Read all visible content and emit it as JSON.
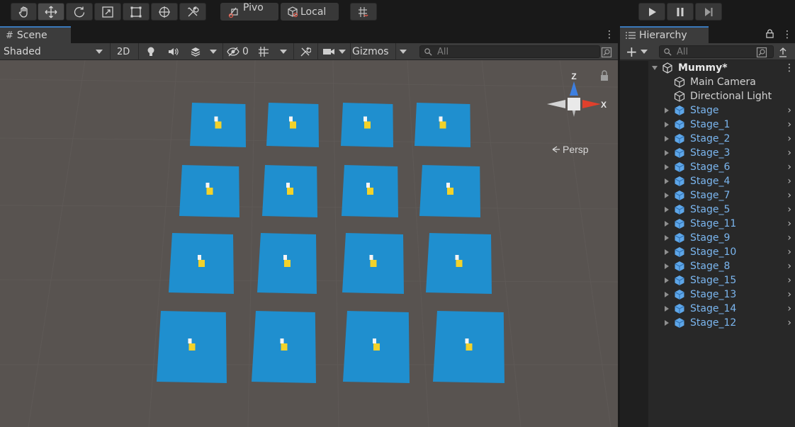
{
  "toolbar": {
    "tools": [
      "hand-tool",
      "move-tool",
      "rotate-tool",
      "scale-tool",
      "rect-tool",
      "transform-tool",
      "custom-tool"
    ],
    "pivot_label": "Pivo",
    "local_label": "Local"
  },
  "scene_panel": {
    "tab_label": "Scene",
    "shading_mode": "Shaded",
    "mode_2d": "2D",
    "hidden_count": "0",
    "gizmos_label": "Gizmos",
    "search_placeholder": "All",
    "axis_y_label": "Z",
    "axis_x_label": "X",
    "projection_label": "Persp"
  },
  "hierarchy": {
    "tab_label": "Hierarchy",
    "search_placeholder": "All",
    "root": "Mummy*",
    "items": [
      {
        "label": "Main Camera",
        "prefab": false
      },
      {
        "label": "Directional Light",
        "prefab": false
      },
      {
        "label": "Stage",
        "prefab": true
      },
      {
        "label": "Stage_1",
        "prefab": true
      },
      {
        "label": "Stage_2",
        "prefab": true
      },
      {
        "label": "Stage_3",
        "prefab": true
      },
      {
        "label": "Stage_6",
        "prefab": true
      },
      {
        "label": "Stage_4",
        "prefab": true
      },
      {
        "label": "Stage_7",
        "prefab": true
      },
      {
        "label": "Stage_5",
        "prefab": true
      },
      {
        "label": "Stage_11",
        "prefab": true
      },
      {
        "label": "Stage_9",
        "prefab": true
      },
      {
        "label": "Stage_10",
        "prefab": true
      },
      {
        "label": "Stage_8",
        "prefab": true
      },
      {
        "label": "Stage_15",
        "prefab": true
      },
      {
        "label": "Stage_13",
        "prefab": true
      },
      {
        "label": "Stage_14",
        "prefab": true
      },
      {
        "label": "Stage_12",
        "prefab": true
      }
    ]
  },
  "colors": {
    "accent": "#3a79bb",
    "stage_tile": "#1f8fcf",
    "prefab_text": "#7bb6ef",
    "ground": "#585350"
  }
}
